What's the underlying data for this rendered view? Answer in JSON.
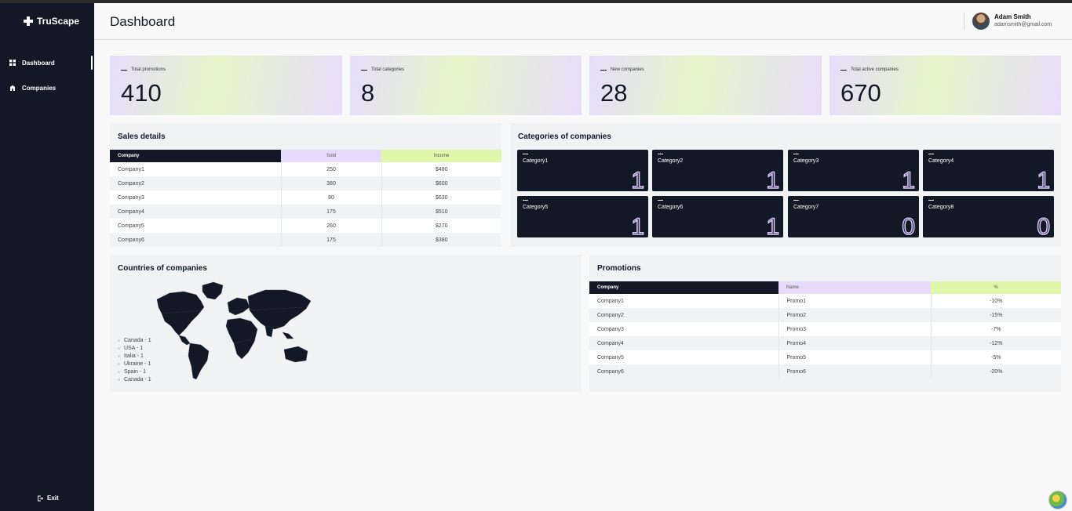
{
  "app": {
    "brand": "TruScape"
  },
  "sidebar": {
    "items": [
      {
        "label": "Dashboard",
        "icon": "grid-icon",
        "active": true
      },
      {
        "label": "Companies",
        "icon": "building-icon",
        "active": false
      }
    ],
    "exit_label": "Exit"
  },
  "header": {
    "title": "Dashboard",
    "user": {
      "name": "Adam Smith",
      "email": "adamsmith@gmail.com"
    }
  },
  "stats": [
    {
      "label": "Total promotions",
      "value": "410"
    },
    {
      "label": "Total categories",
      "value": "8"
    },
    {
      "label": "New companies",
      "value": "28"
    },
    {
      "label": "Total active companies",
      "value": "670"
    }
  ],
  "sales": {
    "title": "Sales details",
    "columns": [
      "Company",
      "Sold",
      "Income"
    ],
    "rows": [
      [
        "Company1",
        "250",
        "$480"
      ],
      [
        "Company2",
        "380",
        "$600"
      ],
      [
        "Company3",
        "80",
        "$630"
      ],
      [
        "Company4",
        "175",
        "$510"
      ],
      [
        "Company5",
        "260",
        "$270"
      ],
      [
        "Company6",
        "175",
        "$380"
      ]
    ]
  },
  "categories": {
    "title": "Categories of companies",
    "items": [
      {
        "name": "Category1",
        "count": "1"
      },
      {
        "name": "Category2",
        "count": "1"
      },
      {
        "name": "Category3",
        "count": "1"
      },
      {
        "name": "Category4",
        "count": "1"
      },
      {
        "name": "Category5",
        "count": "1"
      },
      {
        "name": "Category6",
        "count": "1"
      },
      {
        "name": "Category7",
        "count": "0"
      },
      {
        "name": "Category8",
        "count": "0"
      }
    ]
  },
  "countries": {
    "title": "Countries of companies",
    "legend": [
      "Canada - 1",
      "USA - 1",
      "Italia - 1",
      "Ukraine - 1",
      "Spain - 1",
      "Canada - 1"
    ]
  },
  "promotions": {
    "title": "Promotions",
    "columns": [
      "Company",
      "Name",
      "%"
    ],
    "rows": [
      [
        "Company1",
        "Promo1",
        "-10%"
      ],
      [
        "Company2",
        "Promo2",
        "-15%"
      ],
      [
        "Company3",
        "Promo3",
        "-7%"
      ],
      [
        "Company4",
        "Promo4",
        "-12%"
      ],
      [
        "Company5",
        "Promo5",
        "-5%"
      ],
      [
        "Company6",
        "Promo6",
        "-20%"
      ]
    ]
  },
  "colors": {
    "sidebar_bg": "#121826",
    "purple_tint": "#e6dbfa",
    "lime_tint": "#dff7a8",
    "panel_bg": "#f1f2f4"
  }
}
